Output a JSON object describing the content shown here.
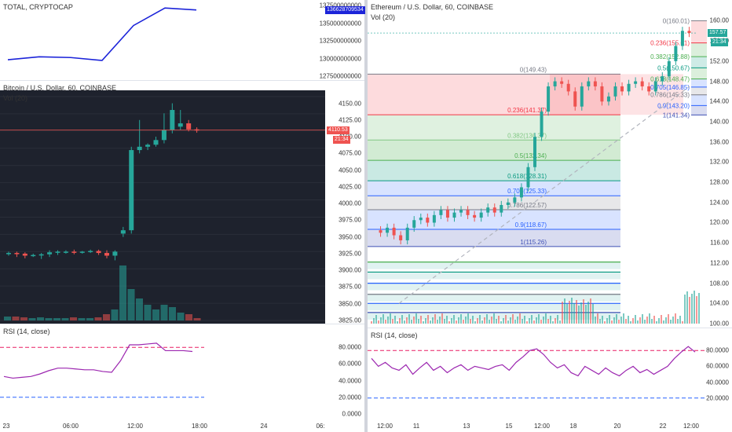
{
  "left": {
    "total": {
      "title": "TOTAL, CRYPTOCAP",
      "ticks": [
        "137500000000",
        "135000000000",
        "132500000000",
        "130000000000",
        "127500000000"
      ],
      "price_tag": "136628709534",
      "chart_data": {
        "type": "line",
        "x": [
          "23 00:00",
          "23 03:00",
          "23 06:00",
          "23 09:00",
          "23 12:00",
          "23 15:00",
          "23 18:00"
        ],
        "values": [
          129800000000,
          130200000000,
          130100000000,
          129700000000,
          134500000000,
          136900000000,
          136628709534
        ],
        "ylim": [
          127000000000,
          138000000000
        ]
      }
    },
    "btc": {
      "title": "Bitcoin / U.S. Dollar, 60, COINBASE",
      "vol": "Vol (20)",
      "ticks": [
        "4150.00",
        "4125.00",
        "4100.00",
        "4075.00",
        "4050.00",
        "4025.00",
        "4000.00",
        "3975.00",
        "3950.00",
        "3925.00",
        "3900.00",
        "3875.00",
        "3850.00",
        "3825.00"
      ],
      "price_tag": "4110.53",
      "time_tag": "21:34",
      "chart_data": {
        "type": "candlestick",
        "open": [
          3925,
          3926,
          3925,
          3922,
          3923,
          3924,
          3927,
          3928,
          3928,
          3927,
          3928,
          3929,
          3926,
          3922,
          3955,
          3960,
          4080,
          4085,
          4088,
          4095,
          4110,
          4115,
          4120,
          4111
        ],
        "close": [
          3926,
          3925,
          3922,
          3923,
          3924,
          3927,
          3928,
          3928,
          3927,
          3928,
          3929,
          3926,
          3922,
          3928,
          3960,
          4080,
          4085,
          4088,
          4095,
          4110,
          4140,
          4120,
          4111,
          4110
        ],
        "high": [
          3928,
          3928,
          3927,
          3925,
          3926,
          3930,
          3930,
          3930,
          3931,
          3929,
          3931,
          3931,
          3930,
          3930,
          3965,
          4085,
          4125,
          4090,
          4100,
          4135,
          4150,
          4140,
          4125,
          4114
        ],
        "low": [
          3922,
          3920,
          3918,
          3920,
          3917,
          3920,
          3923,
          3925,
          3924,
          3925,
          3926,
          3923,
          3918,
          3915,
          3950,
          3955,
          4075,
          4080,
          4085,
          4090,
          4105,
          4110,
          4108,
          4106
        ],
        "volume": [
          5,
          5,
          4,
          3,
          4,
          3,
          3,
          3,
          4,
          3,
          3,
          4,
          8,
          14,
          70,
          40,
          28,
          20,
          14,
          20,
          17,
          10,
          8,
          3
        ],
        "ylim": [
          3825,
          4160
        ]
      }
    },
    "rsi": {
      "title": "RSI (14, close)",
      "ticks": [
        "80.0000",
        "60.0000",
        "40.0000",
        "20.0000",
        "0.0000"
      ],
      "chart_data": {
        "type": "line",
        "values": [
          45,
          43,
          44,
          45,
          48,
          52,
          55,
          55,
          54,
          53,
          53,
          51,
          50,
          64,
          83,
          83,
          84,
          85,
          76,
          76,
          76,
          75
        ],
        "ylim": [
          0,
          100
        ]
      }
    },
    "xaxis": [
      "23",
      "06:00",
      "12:00",
      "18:00",
      "24",
      "06:"
    ]
  },
  "right": {
    "eth": {
      "title": "Ethereum / U.S. Dollar, 60, COINBASE",
      "vol": "Vol (20)",
      "ticks": [
        "160.00",
        "156.00",
        "152.00",
        "148.00",
        "144.00",
        "140.00",
        "136.00",
        "132.00",
        "128.00",
        "124.00",
        "120.00",
        "116.00",
        "112.00",
        "108.00",
        "104.00",
        "100.00"
      ],
      "price_tag": "157.57",
      "time_tag": "21:34",
      "fib_upper": [
        {
          "label": "0(160.01)",
          "value": 160.01,
          "color": "#787b86"
        },
        {
          "label": "0.236(155.61)",
          "value": 155.61,
          "color": "#f23645"
        },
        {
          "label": "0.382(152.88)",
          "value": 152.88,
          "color": "#4caf50"
        },
        {
          "label": "0.5(150.67)",
          "value": 150.67,
          "color": "#089981"
        },
        {
          "label": "0.618(148.47)",
          "value": 148.47,
          "color": "#4caf50"
        },
        {
          "label": "0.705(146.85)",
          "value": 146.85,
          "color": "#2962ff"
        },
        {
          "label": "0.786(145.33)",
          "value": 145.33,
          "color": "#787b86"
        },
        {
          "label": "0.9(143.20)",
          "value": 143.2,
          "color": "#2962ff"
        },
        {
          "label": "1(141.34)",
          "value": 141.34,
          "color": "#3f51b5"
        }
      ],
      "fib_lower": [
        {
          "label": "0(149.43)",
          "value": 149.43,
          "color": "#787b86"
        },
        {
          "label": "0.236(141.37)",
          "value": 141.37,
          "color": "#f23645"
        },
        {
          "label": "0.382(136.37)",
          "value": 136.37,
          "color": "#81c784"
        },
        {
          "label": "0.5(132.34)",
          "value": 132.34,
          "color": "#4caf50"
        },
        {
          "label": "0.618(128.31)",
          "value": 128.31,
          "color": "#089981"
        },
        {
          "label": "0.705(125.33)",
          "value": 125.33,
          "color": "#2962ff"
        },
        {
          "label": "0.786(122.57)",
          "value": 122.57,
          "color": "#787b86"
        },
        {
          "label": "0.9(118.67)",
          "value": 118.67,
          "color": "#2962ff"
        },
        {
          "label": "1(115.26)",
          "value": 115.26,
          "color": "#3f51b5"
        }
      ],
      "fib_extra_levels": [
        112.2,
        110.2,
        108.0,
        105.8,
        104.0,
        102.2
      ],
      "chart_data": {
        "type": "candlestick",
        "ylim": [
          100,
          161
        ],
        "close_path": [
          118.5,
          118,
          119,
          117.5,
          116.5,
          119,
          120.5,
          121,
          120,
          121.5,
          122.5,
          121,
          122,
          122.5,
          121.5,
          121,
          122,
          123,
          122,
          123.5,
          124,
          125,
          127,
          131,
          137,
          142,
          147,
          148,
          147.5,
          146,
          143,
          147,
          148,
          147,
          144,
          145,
          147,
          146,
          147.5,
          148,
          147,
          146,
          148,
          149,
          152,
          155,
          158,
          157.57
        ]
      }
    },
    "rsi": {
      "title": "RSI (14, close)",
      "ticks": [
        "80.0000",
        "60.0000",
        "40.0000",
        "20.0000"
      ],
      "chart_data": {
        "type": "line",
        "ylim": [
          0,
          100
        ],
        "values": [
          70,
          60,
          65,
          58,
          55,
          62,
          50,
          58,
          65,
          55,
          60,
          52,
          58,
          62,
          55,
          60,
          58,
          56,
          60,
          62,
          55,
          65,
          72,
          80,
          82,
          75,
          65,
          58,
          62,
          52,
          48,
          60,
          55,
          50,
          58,
          52,
          48,
          55,
          60,
          52,
          56,
          50,
          55,
          60,
          70,
          78,
          85,
          78
        ]
      }
    },
    "xaxis": [
      "12:00",
      "11",
      "13",
      "15",
      "12:00",
      "18",
      "20",
      "22",
      "12:00"
    ]
  },
  "colors": {
    "up": "#26a69a",
    "down": "#ef5350",
    "bg_dark": "#1e222d",
    "price_line": "#ef5350",
    "rsi": "#9c27b0",
    "rsi_band": "#e91e63",
    "total_line": "#1c24d9"
  }
}
